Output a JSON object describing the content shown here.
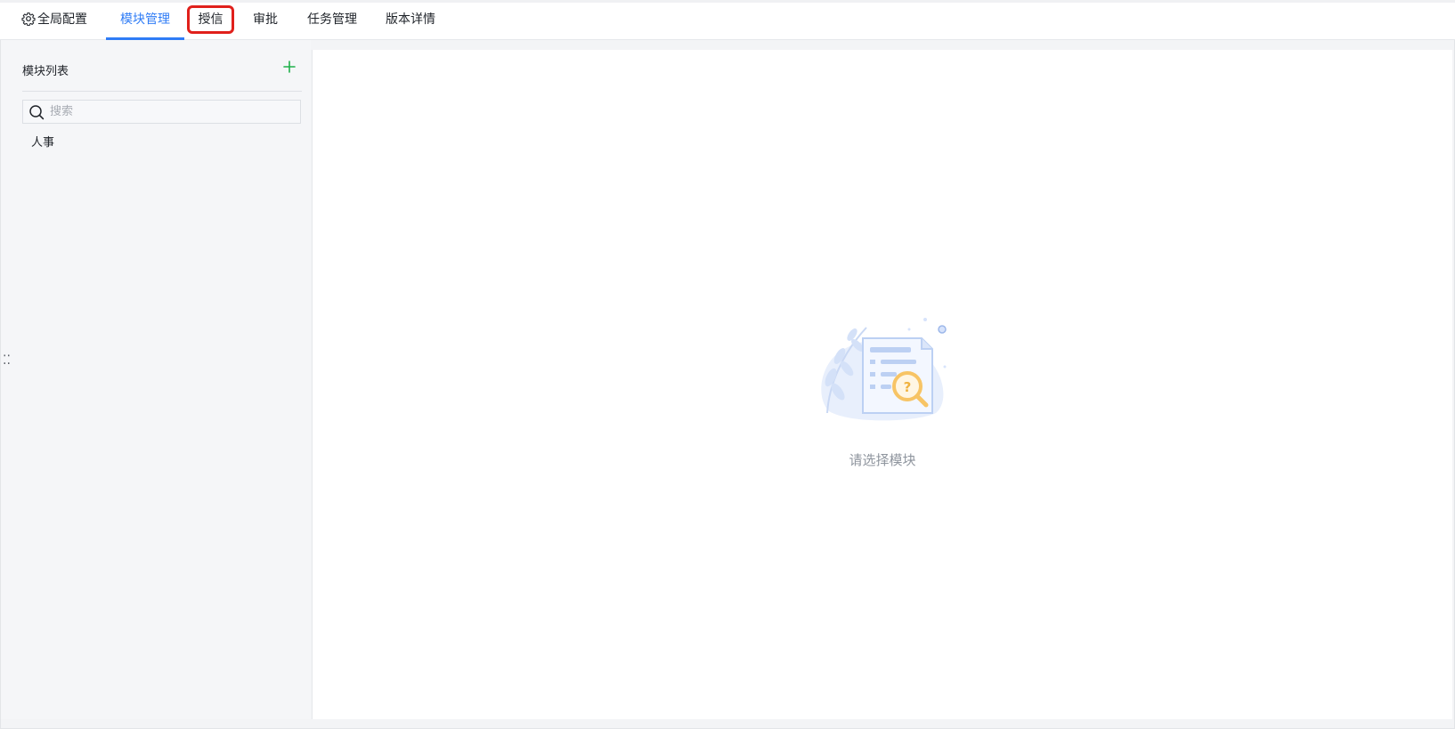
{
  "nav": {
    "global_config": "全局配置",
    "tabs": [
      {
        "label": "模块管理",
        "active": true
      },
      {
        "label": "授信",
        "active": false
      },
      {
        "label": "审批",
        "active": false
      },
      {
        "label": "任务管理",
        "active": false
      },
      {
        "label": "版本详情",
        "active": false
      }
    ]
  },
  "sidebar": {
    "title": "模块列表",
    "add_icon": "plus-icon",
    "search": {
      "placeholder": "搜索",
      "value": ""
    },
    "items": [
      {
        "label": "人事"
      }
    ]
  },
  "main": {
    "empty_text": "请选择模块",
    "empty_icon": "document-search-illustration"
  },
  "colors": {
    "accent": "#2f7cf6",
    "add": "#1fb04a",
    "highlight": "#e0201b"
  }
}
